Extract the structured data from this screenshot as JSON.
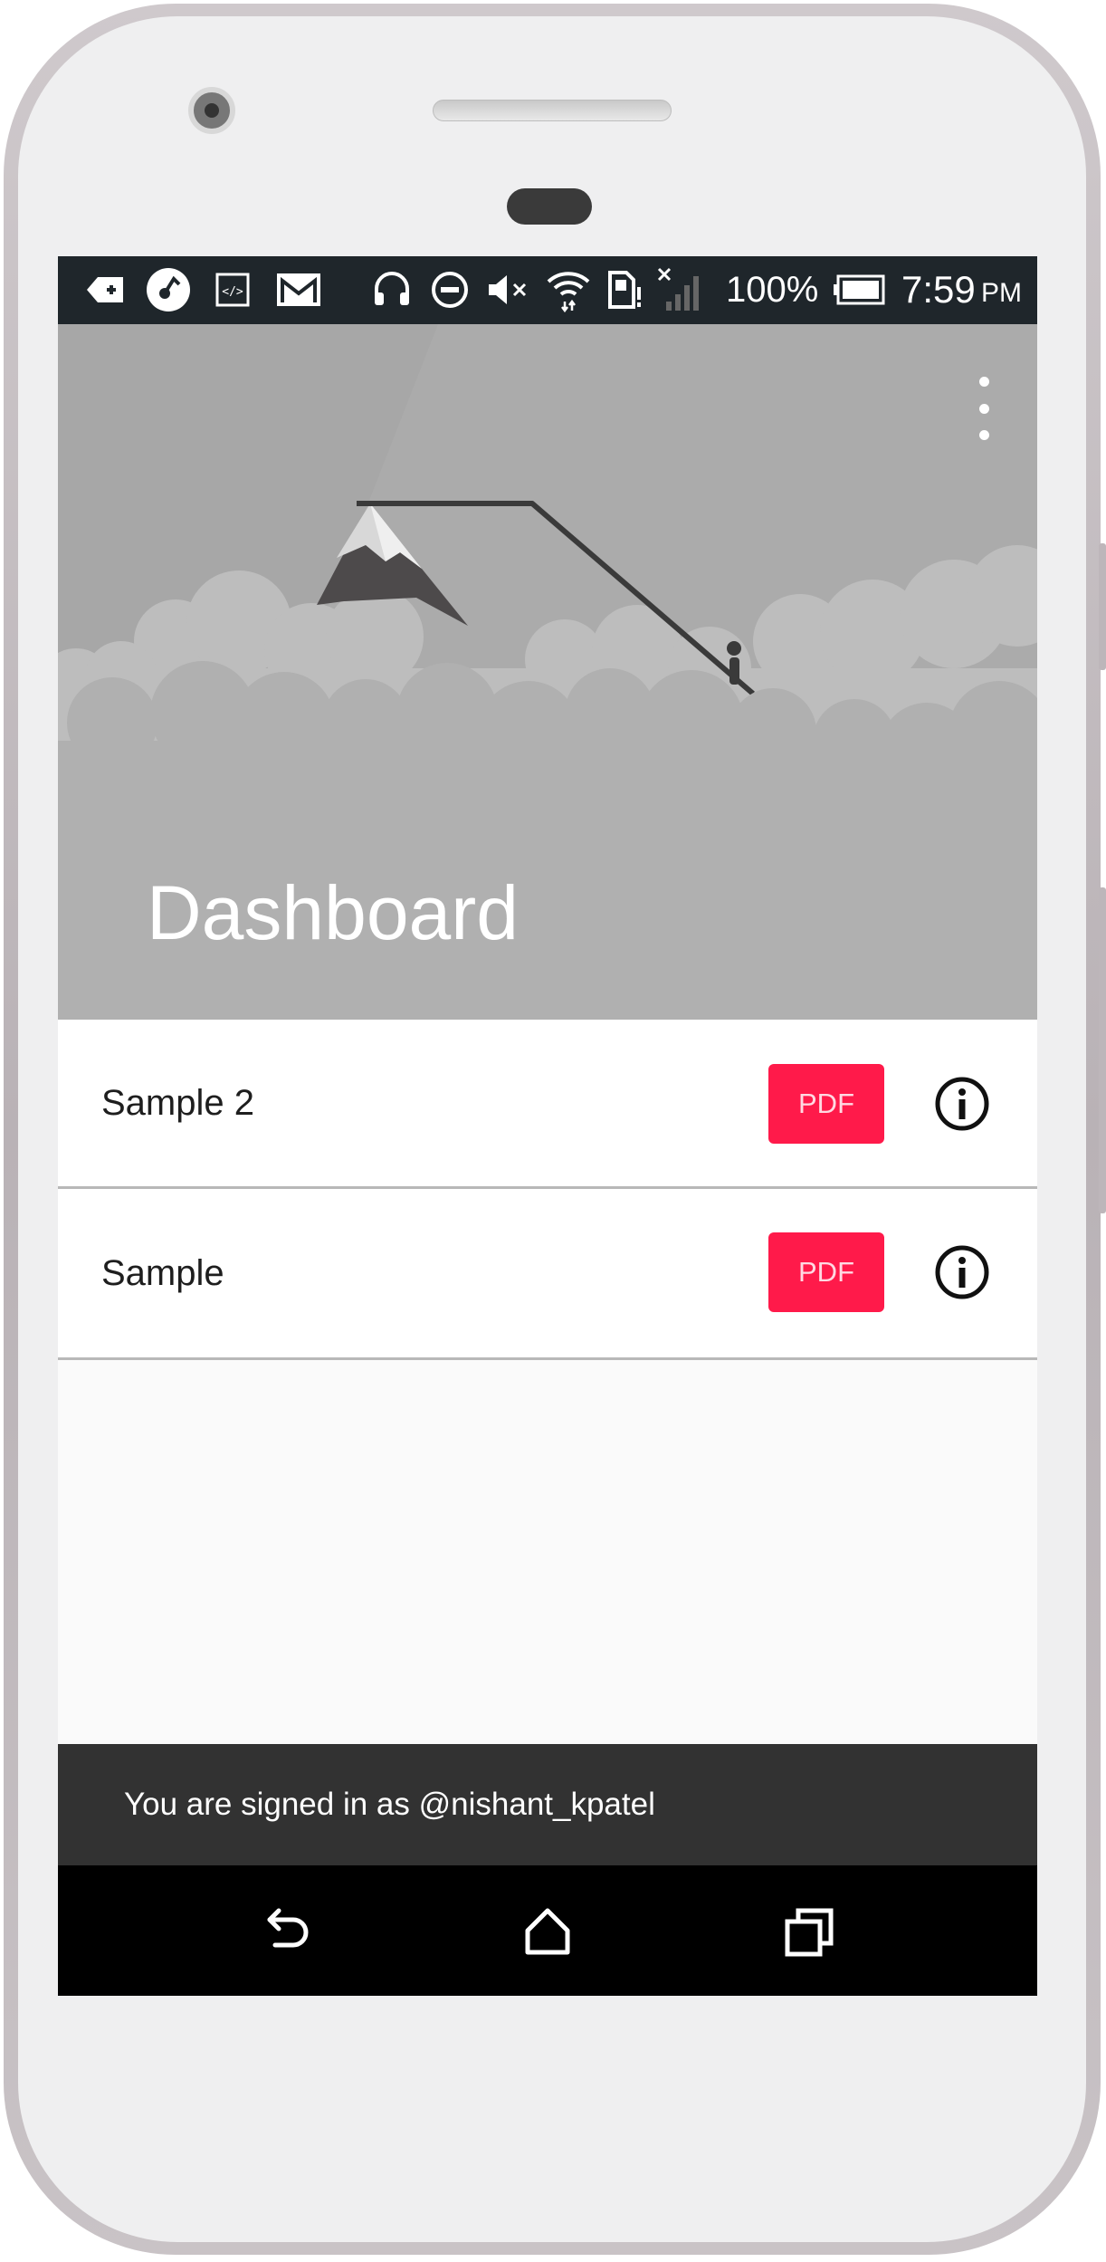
{
  "status_bar": {
    "battery": "100%",
    "time": "7:59",
    "ampm": "PM",
    "icons": [
      "tag-add-icon",
      "app-icon",
      "code-icon",
      "gmail-icon",
      "headset-icon",
      "do-not-disturb-icon",
      "mute-icon",
      "wifi-icon",
      "sim-icon",
      "no-signal-icon",
      "battery-icon"
    ]
  },
  "header": {
    "title": "Dashboard",
    "menu_icon": "more-vert-icon"
  },
  "documents": [
    {
      "name": "Sample 2",
      "pdf_label": "PDF",
      "info_icon": "info-icon"
    },
    {
      "name": "Sample",
      "pdf_label": "PDF",
      "info_icon": "info-icon"
    }
  ],
  "snackbar": {
    "text": "You are signed in as @nishant_kpatel"
  },
  "nav_bar": {
    "buttons": [
      "back-icon",
      "home-icon",
      "recents-icon"
    ]
  },
  "colors": {
    "accent": "#ff1a4a",
    "header_bg": "#a7a7a7",
    "status_bar_bg": "#1f262b",
    "snackbar_bg": "#323232"
  }
}
